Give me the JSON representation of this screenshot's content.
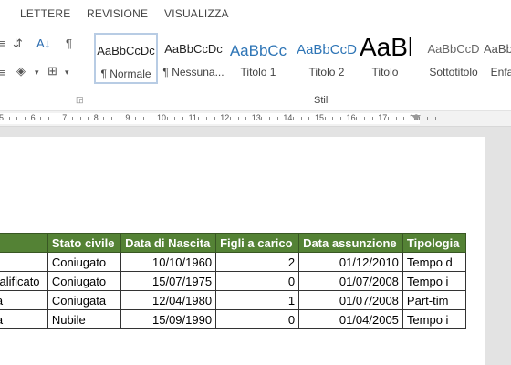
{
  "tabs": [
    "LETTERE",
    "REVISIONE",
    "VISUALIZZA"
  ],
  "styles": [
    {
      "preview": "AaBbCcDc",
      "label": "¶ Normale",
      "selected": true,
      "font_size": 13,
      "color": "#222222"
    },
    {
      "preview": "AaBbCcDc",
      "label": "¶ Nessuna...",
      "selected": false,
      "font_size": 13,
      "color": "#222222"
    },
    {
      "preview": "AaBbCc",
      "label": "Titolo 1",
      "selected": false,
      "font_size": 17,
      "color": "#2e75b6"
    },
    {
      "preview": "AaBbCcD",
      "label": "Titolo 2",
      "selected": false,
      "font_size": 15,
      "color": "#2e75b6"
    },
    {
      "preview": "AaBl",
      "label": "Titolo",
      "selected": false,
      "font_size": 28,
      "color": "#000000"
    },
    {
      "preview": "AaBbCcD",
      "label": "Sottotitolo",
      "selected": false,
      "font_size": 13,
      "color": "#666666"
    },
    {
      "preview": "AaBbCcD",
      "label": "Enfa",
      "selected": false,
      "font_size": 13,
      "color": "#555555"
    }
  ],
  "group_label": "Stili",
  "ruler": {
    "numbers": [
      "5",
      "6",
      "7",
      "8",
      "9",
      "10",
      "11",
      "12",
      "13",
      "14",
      "15",
      "16",
      "17",
      "18"
    ]
  },
  "table": {
    "headers": [
      "a",
      "Stato civile",
      "Data di Nascita",
      "Figli a carico",
      "Data assunzione",
      "Tipologia"
    ],
    "rows": [
      [
        "o",
        "Coniugato",
        "10/10/1960",
        "2",
        "01/12/2010",
        "Tempo d"
      ],
      [
        "qualificato",
        "Coniugato",
        "15/07/1975",
        "0",
        "01/07/2008",
        "Tempo i"
      ],
      [
        "ata",
        "Coniugata",
        "12/04/1980",
        "1",
        "01/07/2008",
        "Part-tim"
      ],
      [
        "ata",
        "Nubile",
        "15/09/1990",
        "0",
        "01/04/2005",
        "Tempo i"
      ]
    ]
  },
  "colors": {
    "header_bg": "#548235",
    "accent": "#2b579a"
  }
}
